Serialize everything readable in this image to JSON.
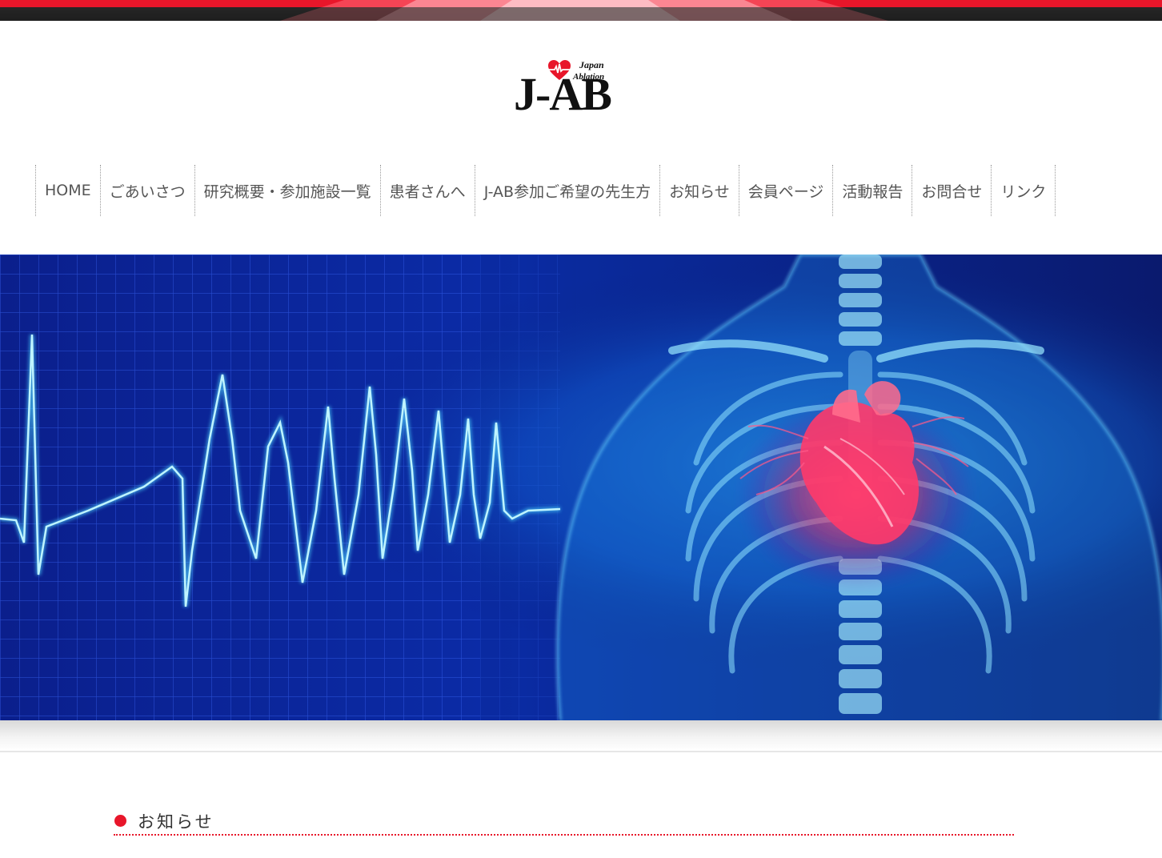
{
  "brand": {
    "logo_main": "J-AB",
    "logo_sub_1": "Japan",
    "logo_sub_2": "Ablation"
  },
  "nav": {
    "items": [
      {
        "label": "HOME"
      },
      {
        "label": "ごあいさつ"
      },
      {
        "label": "研究概要・参加施設一覧"
      },
      {
        "label": "患者さんへ"
      },
      {
        "label": "J-AB参加ご希望の先生方"
      },
      {
        "label": "お知らせ"
      },
      {
        "label": "会員ページ"
      },
      {
        "label": "活動報告"
      },
      {
        "label": "お問合せ"
      },
      {
        "label": "リンク"
      }
    ]
  },
  "hero": {
    "image": "ecg-and-heart-xray-banner"
  },
  "news": {
    "heading": "お知らせ"
  },
  "colors": {
    "accent": "#e8162a",
    "hero_blue": "#0a2a9a",
    "heart_pink": "#ff3a6a"
  }
}
